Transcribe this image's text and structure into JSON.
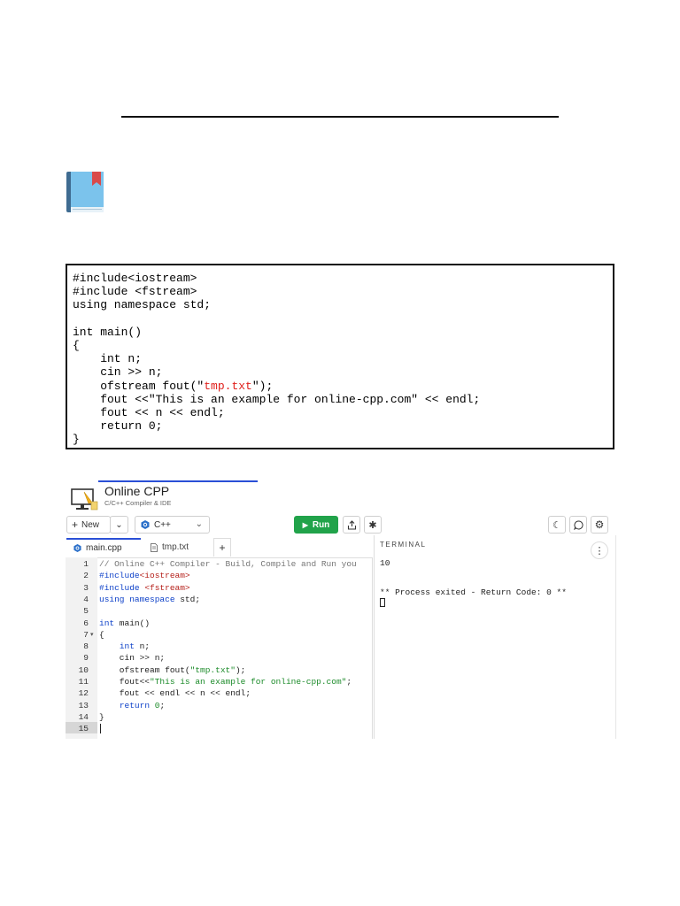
{
  "document_code": {
    "lines": [
      "#include<iostream>",
      "#include <fstream>",
      "using namespace std;",
      "",
      "int main()",
      "{",
      "    int n;",
      "    cin >> n;",
      "    ofstream fout(\"tmp.txt\");",
      "    fout <<\"This is an example for online-cpp.com\" << endl;",
      "    fout << n << endl;",
      "    return 0;",
      "}"
    ]
  },
  "ide": {
    "brand": "Online CPP",
    "subtitle": "C/C++ Compiler & IDE",
    "toolbar": {
      "new_label": "New",
      "language": "C++",
      "run_label": "Run"
    },
    "tabs": [
      {
        "label": "main.cpp",
        "active": true
      },
      {
        "label": "tmp.txt",
        "active": false
      }
    ],
    "add_tab_label": "+",
    "line_numbers": [
      "1",
      "2",
      "3",
      "4",
      "5",
      "6",
      "7",
      "8",
      "9",
      "10",
      "11",
      "12",
      "13",
      "14",
      "15"
    ],
    "editor_lines": [
      "// Online C++ Compiler - Build, Compile and Run you",
      "#include<iostream>",
      "#include <fstream>",
      "using namespace std;",
      "",
      "int main()",
      "{",
      "    int n;",
      "    cin >> n;",
      "    ofstream fout(\"tmp.txt\");",
      "    fout<<\"This is an example for online-cpp.com\";",
      "    fout << endl << n << endl;",
      "    return 0;",
      "}",
      ""
    ],
    "terminal": {
      "title": "TERMINAL",
      "menu_glyph": "⋮",
      "output_1": "10",
      "output_2": "** Process exited - Return Code: 0 **"
    }
  },
  "colors": {
    "run_button": "#21a34a",
    "accent_blue": "#2a4fd6",
    "string_red": "#e0201c"
  }
}
